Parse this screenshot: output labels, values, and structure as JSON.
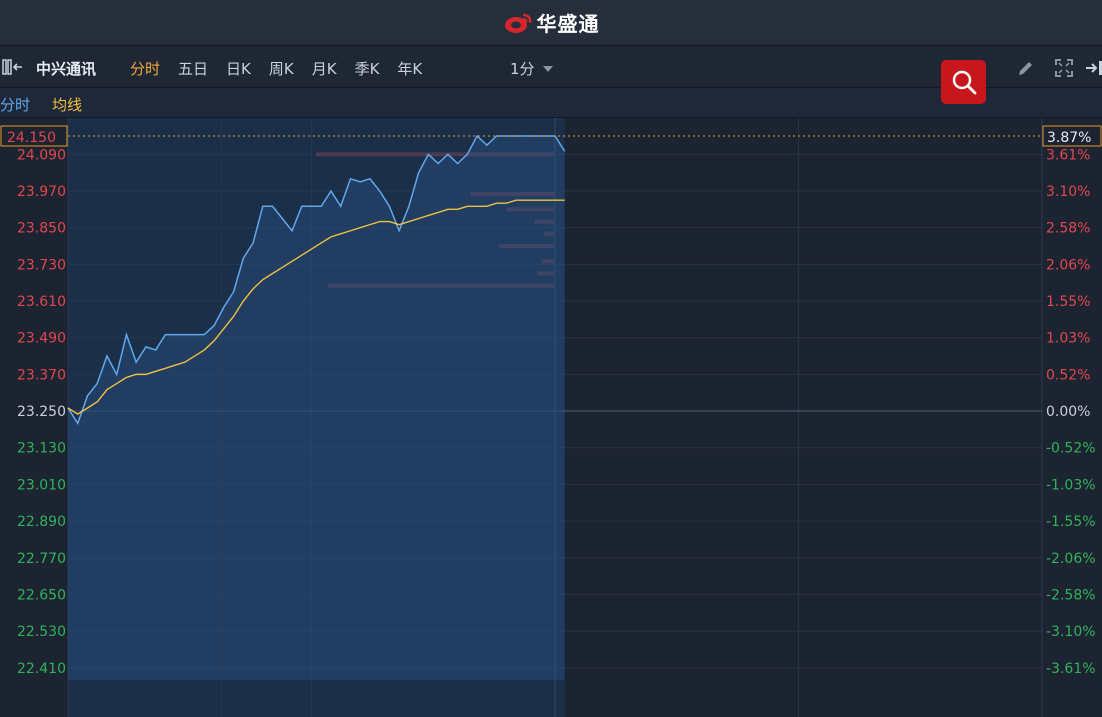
{
  "app": {
    "brand": "华盛通"
  },
  "toolbar": {
    "stock_name": "中兴通讯",
    "tabs": [
      {
        "label": "分时",
        "active": true
      },
      {
        "label": "五日",
        "active": false
      },
      {
        "label": "日K",
        "active": false
      },
      {
        "label": "周K",
        "active": false
      },
      {
        "label": "月K",
        "active": false
      },
      {
        "label": "季K",
        "active": false
      },
      {
        "label": "年K",
        "active": false
      }
    ],
    "interval": "1分"
  },
  "legend": {
    "line": "分时",
    "average": "均线"
  },
  "colors": {
    "up": "#e2474e",
    "down": "#2fb35a",
    "flat": "#c9d1dc",
    "price_line": "#5fa8ee",
    "avg_line": "#f0c040",
    "accent": "#f0a93c",
    "depth_bar": "#8b3a3d",
    "search_red": "#c8161d"
  },
  "chart_data": {
    "type": "line",
    "base_price": 23.25,
    "current_price": "24.150",
    "current_change": "3.87%",
    "ylim": [
      22.37,
      24.15
    ],
    "y_ticks_left": [
      "24.090",
      "23.970",
      "23.850",
      "23.730",
      "23.610",
      "23.490",
      "23.370",
      "23.250",
      "23.130",
      "23.010",
      "22.890",
      "22.770",
      "22.650",
      "22.530",
      "22.410"
    ],
    "y_ticks_right": [
      "3.61%",
      "3.10%",
      "2.58%",
      "2.06%",
      "1.55%",
      "1.03%",
      "0.52%",
      "0.00%",
      "-0.52%",
      "-1.03%",
      "-1.55%",
      "-2.06%",
      "-2.58%",
      "-3.10%",
      "-3.61%"
    ],
    "y_tick_values": [
      24.09,
      23.97,
      23.85,
      23.73,
      23.61,
      23.49,
      23.37,
      23.25,
      23.13,
      23.01,
      22.89,
      22.77,
      22.65,
      22.53,
      22.41
    ],
    "x_minutes_total": 330,
    "series": [
      {
        "key": "price",
        "values": [
          23.26,
          23.21,
          23.3,
          23.34,
          23.43,
          23.37,
          23.5,
          23.41,
          23.46,
          23.45,
          23.5,
          23.5,
          23.5,
          23.5,
          23.5,
          23.53,
          23.59,
          23.64,
          23.75,
          23.8,
          23.92,
          23.92,
          23.88,
          23.84,
          23.92,
          23.92,
          23.92,
          23.97,
          23.92,
          24.01,
          24.0,
          24.01,
          23.97,
          23.92,
          23.84,
          23.92,
          24.03,
          24.09,
          24.06,
          24.09,
          24.06,
          24.09,
          24.15,
          24.12,
          24.15,
          24.15,
          24.15,
          24.15,
          24.15,
          24.15,
          24.15,
          24.1
        ]
      },
      {
        "key": "average",
        "values": [
          23.26,
          23.24,
          23.26,
          23.28,
          23.32,
          23.34,
          23.36,
          23.37,
          23.37,
          23.38,
          23.39,
          23.4,
          23.41,
          23.43,
          23.45,
          23.48,
          23.52,
          23.56,
          23.61,
          23.65,
          23.68,
          23.7,
          23.72,
          23.74,
          23.76,
          23.78,
          23.8,
          23.82,
          23.83,
          23.84,
          23.85,
          23.86,
          23.87,
          23.87,
          23.86,
          23.87,
          23.88,
          23.89,
          23.9,
          23.91,
          23.91,
          23.92,
          23.92,
          23.92,
          23.93,
          23.93,
          23.94,
          23.94,
          23.94,
          23.94,
          23.94,
          23.94
        ]
      }
    ],
    "depth_bars": [
      {
        "price": 24.09,
        "size": 1.0
      },
      {
        "price": 23.96,
        "size": 0.35
      },
      {
        "price": 23.91,
        "size": 0.2
      },
      {
        "price": 23.87,
        "size": 0.08
      },
      {
        "price": 23.83,
        "size": 0.04
      },
      {
        "price": 23.79,
        "size": 0.23
      },
      {
        "price": 23.74,
        "size": 0.05
      },
      {
        "price": 23.7,
        "size": 0.07
      },
      {
        "price": 23.66,
        "size": 0.95
      }
    ]
  }
}
